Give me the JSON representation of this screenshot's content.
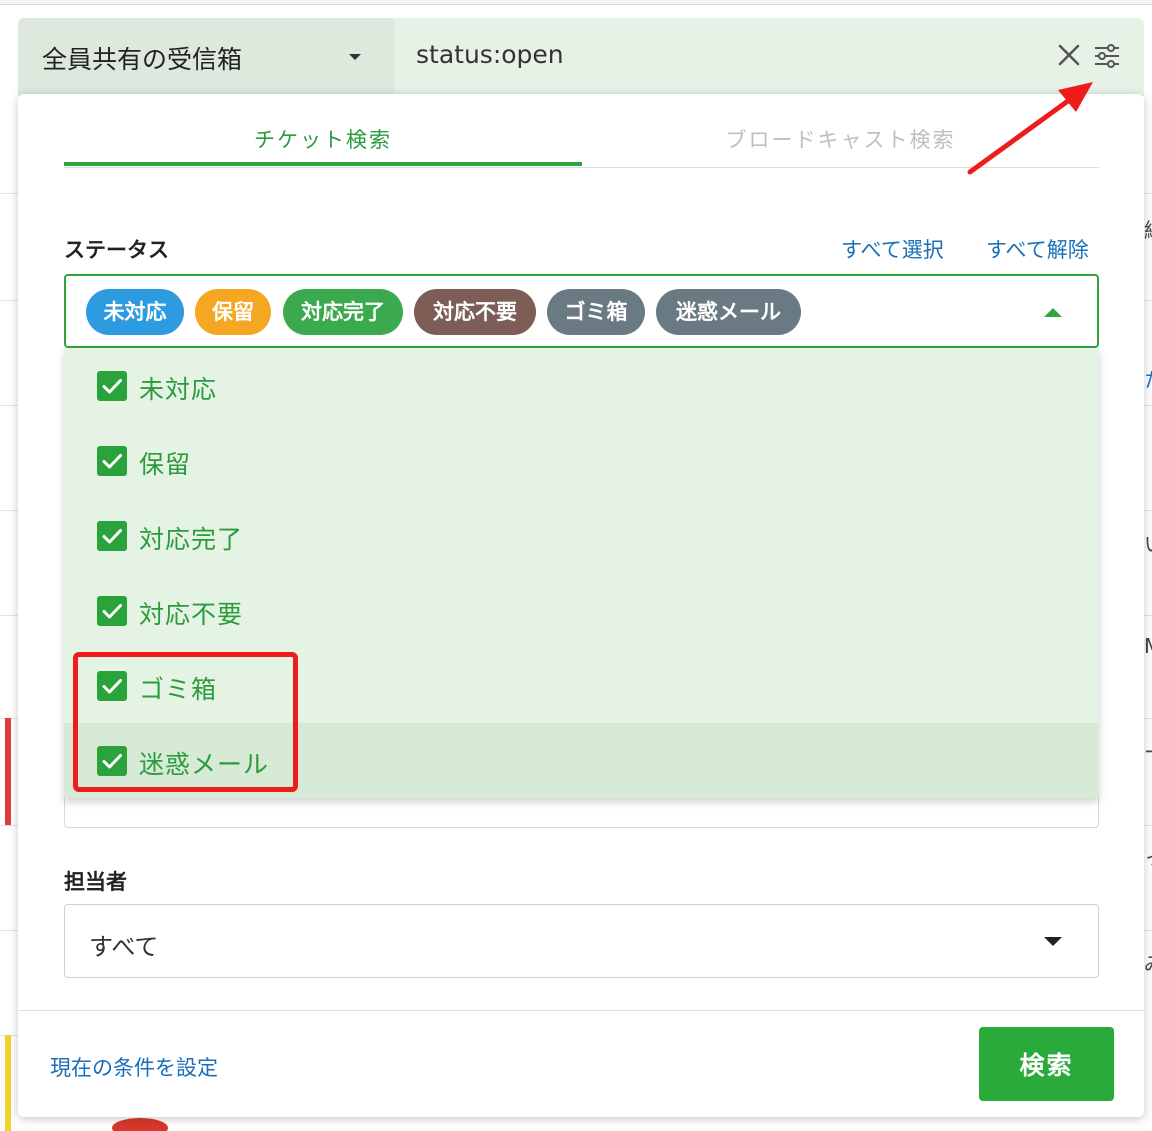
{
  "search_bar": {
    "inbox_label": "全員共有の受信箱",
    "query": "status:open"
  },
  "background_fragments": [
    "絆",
    "た",
    "い",
    "M",
    "ー",
    "っ",
    "み"
  ],
  "panel": {
    "tabs": [
      {
        "label": "チケット検索",
        "active": true
      },
      {
        "label": "ブロードキャスト検索",
        "active": false
      }
    ],
    "status_field": {
      "label": "ステータス",
      "select_all": "すべて選択",
      "clear_all": "すべて解除",
      "chips": [
        {
          "label": "未対応",
          "color": "#2c9be0"
        },
        {
          "label": "保留",
          "color": "#f5a623"
        },
        {
          "label": "対応完了",
          "color": "#3ba94d"
        },
        {
          "label": "対応不要",
          "color": "#7d5d55"
        },
        {
          "label": "ゴミ箱",
          "color": "#6a7a82"
        },
        {
          "label": "迷惑メール",
          "color": "#6a7a82"
        }
      ],
      "options": [
        {
          "label": "未対応",
          "checked": true
        },
        {
          "label": "保留",
          "checked": true
        },
        {
          "label": "対応完了",
          "checked": true
        },
        {
          "label": "対応不要",
          "checked": true
        },
        {
          "label": "ゴミ箱",
          "checked": true
        },
        {
          "label": "迷惑メール",
          "checked": true
        }
      ]
    },
    "assignee_field": {
      "label": "担当者",
      "value": "すべて"
    },
    "footer": {
      "set_current_link": "現在の条件を設定",
      "search_button": "検索"
    }
  },
  "colors": {
    "accent_green": "#2fa53b",
    "link_blue": "#1a6fb8",
    "annotation_red": "#ee1c1c",
    "dropdown_bg": "#e5f3e5"
  }
}
